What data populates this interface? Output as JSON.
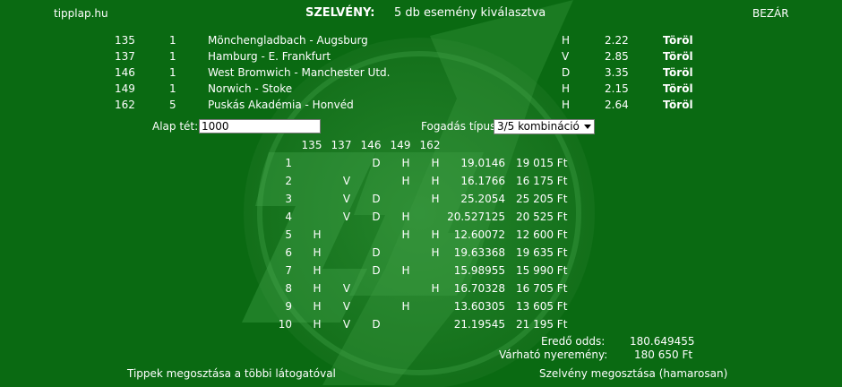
{
  "header": {
    "site": "tipplap.hu",
    "title_label": "SZELVÉNY:",
    "title_text": "5 db esemény kiválasztva",
    "close_label": "BEZÁR"
  },
  "selections": [
    {
      "id": "135",
      "tip": "1",
      "match": "Mönchengladbach - Augsburg",
      "outcome": "H",
      "odds": "2.22",
      "remove": "Töröl"
    },
    {
      "id": "137",
      "tip": "1",
      "match": "Hamburg - E. Frankfurt",
      "outcome": "V",
      "odds": "2.85",
      "remove": "Töröl"
    },
    {
      "id": "146",
      "tip": "1",
      "match": "West Bromwich - Manchester Utd.",
      "outcome": "D",
      "odds": "3.35",
      "remove": "Töröl"
    },
    {
      "id": "149",
      "tip": "1",
      "match": "Norwich - Stoke",
      "outcome": "H",
      "odds": "2.15",
      "remove": "Töröl"
    },
    {
      "id": "162",
      "tip": "5",
      "match": "Puskás Akadémia - Honvéd",
      "outcome": "H",
      "odds": "2.64",
      "remove": "Töröl"
    }
  ],
  "stake": {
    "label": "Alap tét:",
    "value": "1000"
  },
  "bet_type": {
    "label": "Fogadás típus:",
    "selected": "3/5 kombináció"
  },
  "combo_header": [
    "135",
    "137",
    "146",
    "149",
    "162"
  ],
  "combos": [
    {
      "n": "1",
      "cells": [
        "",
        "",
        "D",
        "H",
        "H"
      ],
      "odds": "19.0146",
      "win": "19 015 Ft"
    },
    {
      "n": "2",
      "cells": [
        "",
        "V",
        "",
        "H",
        "H"
      ],
      "odds": "16.1766",
      "win": "16 175 Ft"
    },
    {
      "n": "3",
      "cells": [
        "",
        "V",
        "D",
        "",
        "H"
      ],
      "odds": "25.2054",
      "win": "25 205 Ft"
    },
    {
      "n": "4",
      "cells": [
        "",
        "V",
        "D",
        "H",
        ""
      ],
      "odds": "20.527125",
      "win": "20 525 Ft"
    },
    {
      "n": "5",
      "cells": [
        "H",
        "",
        "",
        "H",
        "H"
      ],
      "odds": "12.60072",
      "win": "12 600 Ft"
    },
    {
      "n": "6",
      "cells": [
        "H",
        "",
        "D",
        "",
        "H"
      ],
      "odds": "19.63368",
      "win": "19 635 Ft"
    },
    {
      "n": "7",
      "cells": [
        "H",
        "",
        "D",
        "H",
        ""
      ],
      "odds": "15.98955",
      "win": "15 990 Ft"
    },
    {
      "n": "8",
      "cells": [
        "H",
        "V",
        "",
        "",
        "H"
      ],
      "odds": "16.70328",
      "win": "16 705 Ft"
    },
    {
      "n": "9",
      "cells": [
        "H",
        "V",
        "",
        "H",
        ""
      ],
      "odds": "13.60305",
      "win": "13 605 Ft"
    },
    {
      "n": "10",
      "cells": [
        "H",
        "V",
        "D",
        "",
        ""
      ],
      "odds": "21.19545",
      "win": "21 195 Ft"
    }
  ],
  "summary": {
    "total_odds_label": "Eredő odds:",
    "total_odds_value": "180.649455",
    "expected_win_label": "Várható nyeremény:",
    "expected_win_value": "180 650 Ft"
  },
  "footer": {
    "share_tips": "Tippek megosztása a többi látogatóval",
    "share_slip": "Szelvény megosztása (hamarosan)"
  },
  "colors": {
    "background": "#0a6a12",
    "text": "#ffffff",
    "watermark": "#2f8f35"
  },
  "watermark_icon": "tipplap-logo-watermark"
}
